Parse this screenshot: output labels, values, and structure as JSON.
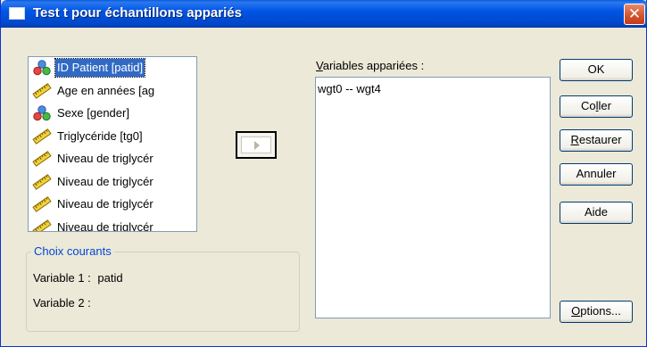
{
  "window": {
    "title": "Test t pour échantillons appariés",
    "close_glyph": "✕"
  },
  "source_list": {
    "items": [
      {
        "label": "ID Patient [patid]",
        "icon": "nominal-variable-icon",
        "selected": true
      },
      {
        "label": "Age en années [ag",
        "icon": "scale-variable-icon"
      },
      {
        "label": "Sexe [gender]",
        "icon": "nominal-variable-icon"
      },
      {
        "label": "Triglycéride [tg0]",
        "icon": "scale-variable-icon"
      },
      {
        "label": "Niveau de triglycér",
        "icon": "scale-variable-icon"
      },
      {
        "label": "Niveau de triglycér",
        "icon": "scale-variable-icon"
      },
      {
        "label": "Niveau de triglycér",
        "icon": "scale-variable-icon"
      },
      {
        "label": "Niveau de triglycér",
        "icon": "scale-variable-icon"
      }
    ]
  },
  "current_choices": {
    "title": "Choix courants",
    "var1_label": "Variable 1 :",
    "var1_value": "patid",
    "var2_label": "Variable 2 :"
  },
  "paired": {
    "label_first": "V",
    "label_rest": "ariables appariées :",
    "items": [
      "wgt0 -- wgt4"
    ]
  },
  "buttons": {
    "ok": "OK",
    "paste_pre": "Co",
    "paste_u": "l",
    "paste_post": "ler",
    "reset_pre": "",
    "reset_u": "R",
    "reset_post": "estaurer",
    "cancel": "Annuler",
    "help": "Aide",
    "options_pre": "",
    "options_u": "O",
    "options_post": "ptions..."
  }
}
